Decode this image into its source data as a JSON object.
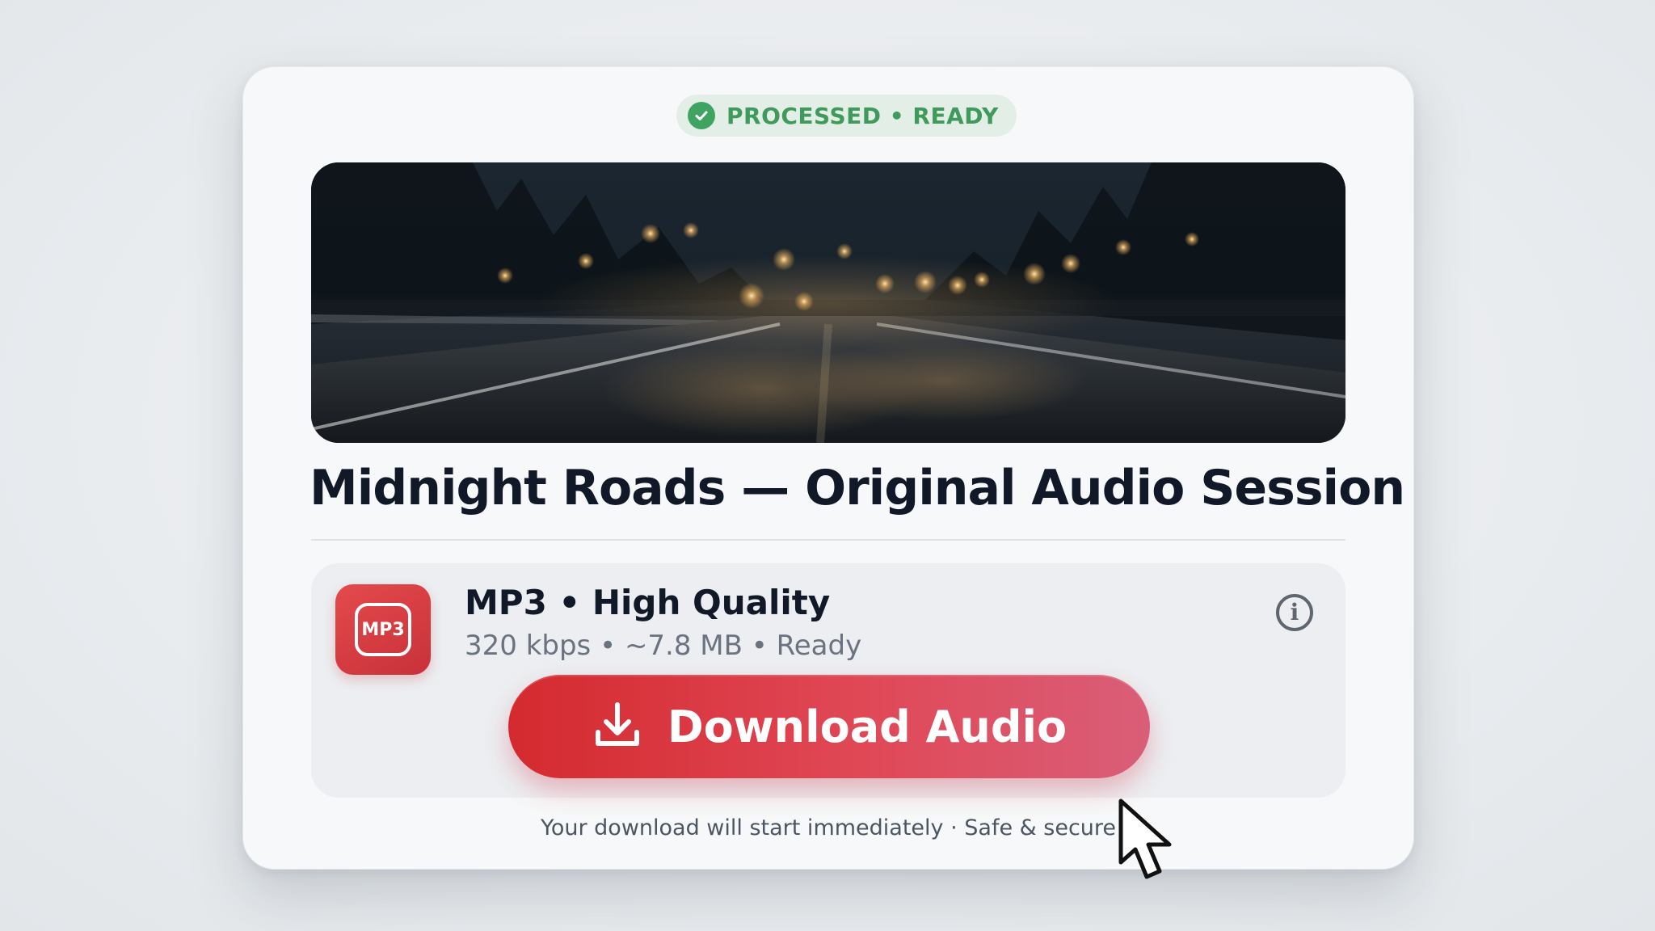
{
  "status": {
    "label": "PROCESSED • READY",
    "color": "#3fa461"
  },
  "hero": {
    "description_icon": "night-road-image"
  },
  "track": {
    "title": "Midnight Roads — Original Audio Session"
  },
  "format": {
    "icon_label": "MP3",
    "title": "MP3 • High Quality",
    "meta": "320 kbps • ~7.8 MB • Ready",
    "info_icon": "info-icon"
  },
  "download": {
    "label": "Download Audio",
    "icon": "download-icon",
    "accent": "#d42a2f"
  },
  "footer": {
    "note": "Your download will start immediately · Safe & secure"
  }
}
